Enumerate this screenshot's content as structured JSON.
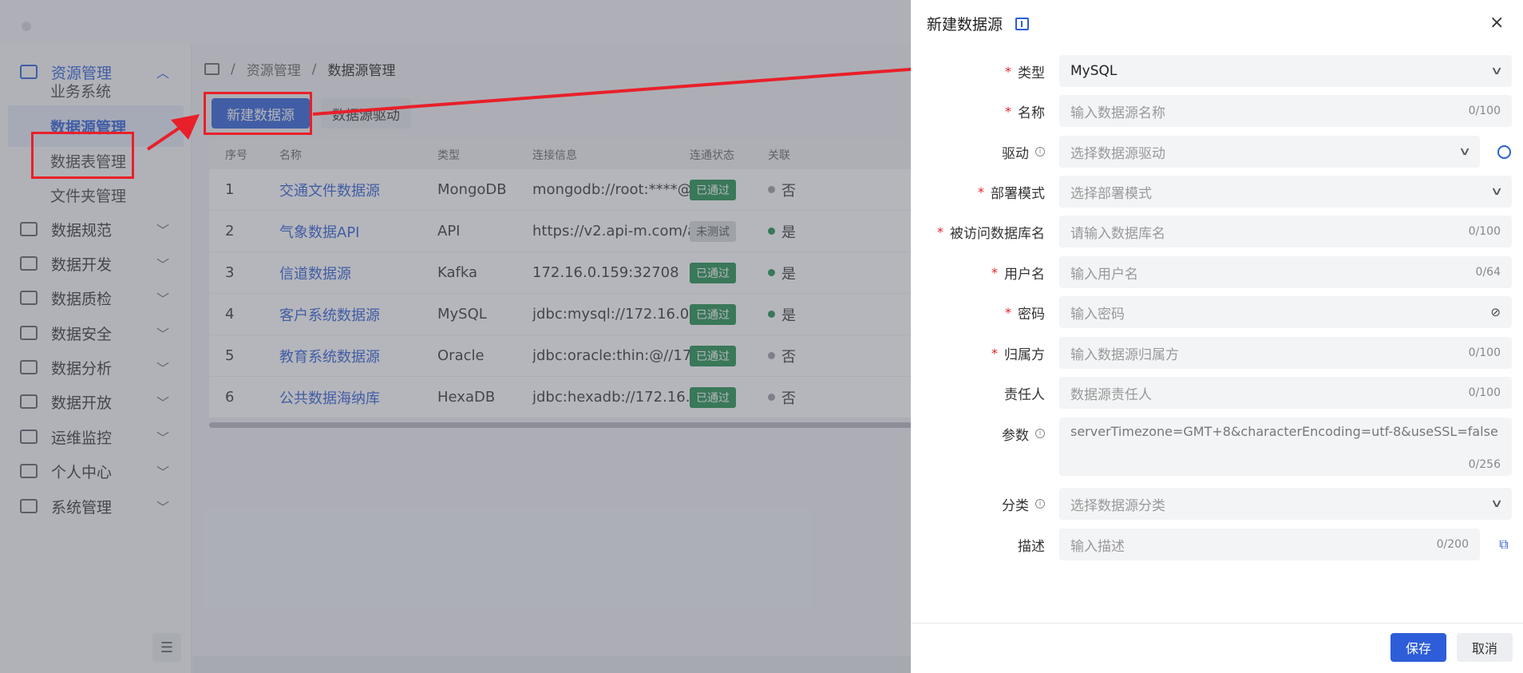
{
  "sidebar": {
    "menu": [
      {
        "label": "资源管理",
        "icon": "monitor-icon",
        "expanded": true
      },
      {
        "label": "数据规范",
        "icon": "display-icon"
      },
      {
        "label": "数据开发",
        "icon": "code-icon"
      },
      {
        "label": "数据质检",
        "icon": "list-icon"
      },
      {
        "label": "数据安全",
        "icon": "check-icon"
      },
      {
        "label": "数据分析",
        "icon": "analysis-icon"
      },
      {
        "label": "数据开放",
        "icon": "open-icon"
      },
      {
        "label": "运维监控",
        "icon": "chart-line-icon"
      },
      {
        "label": "个人中心",
        "icon": "user-icon"
      },
      {
        "label": "系统管理",
        "icon": "settings-icon"
      }
    ],
    "submenu": [
      {
        "label": "业务系统"
      },
      {
        "label": "数据源管理"
      },
      {
        "label": "数据表管理"
      },
      {
        "label": "文件夹管理"
      }
    ]
  },
  "breadcrumb": {
    "root": "资源管理",
    "current": "数据源管理"
  },
  "toolbar": {
    "new_label": "新建数据源",
    "driver_label": "数据源驱动"
  },
  "table": {
    "headers": {
      "no": "序号",
      "name": "名称",
      "type": "类型",
      "conn": "连接信息",
      "status": "连通状态",
      "rel": "关联"
    },
    "rows": [
      {
        "no": "1",
        "name": "交通文件数据源",
        "type": "MongoDB",
        "conn": "mongodb://root:****@...",
        "status": "已通过",
        "rel": "否"
      },
      {
        "no": "2",
        "name": "气象数据API",
        "type": "API",
        "conn": "https://v2.api-m.com/a...",
        "status": "未测试",
        "rel": "是"
      },
      {
        "no": "3",
        "name": "信道数据源",
        "type": "Kafka",
        "conn": "172.16.0.159:32708",
        "status": "已通过",
        "rel": "是"
      },
      {
        "no": "4",
        "name": "客户系统数据源",
        "type": "MySQL",
        "conn": "jdbc:mysql://172.16.0.6...",
        "status": "已通过",
        "rel": "是"
      },
      {
        "no": "5",
        "name": "教育系统数据源",
        "type": "Oracle",
        "conn": "jdbc:oracle:thin:@//17...",
        "status": "已通过",
        "rel": "否"
      },
      {
        "no": "6",
        "name": "公共数据海纳库",
        "type": "HexaDB",
        "conn": "jdbc:hexadb://172.16.0....",
        "status": "已通过",
        "rel": "否"
      }
    ]
  },
  "drawer": {
    "title": "新建数据源",
    "fields": {
      "type": {
        "label": "类型",
        "value": "MySQL"
      },
      "name": {
        "label": "名称",
        "placeholder": "输入数据源名称",
        "count": "0/100"
      },
      "driver": {
        "label": "驱动",
        "placeholder": "选择数据源驱动"
      },
      "deploy": {
        "label": "部署模式",
        "placeholder": "选择部署模式"
      },
      "dbname": {
        "label": "被访问数据库名",
        "placeholder": "请输入数据库名",
        "count": "0/100"
      },
      "username": {
        "label": "用户名",
        "placeholder": "输入用户名",
        "count": "0/64"
      },
      "password": {
        "label": "密码",
        "placeholder": "输入密码"
      },
      "owner": {
        "label": "归属方",
        "placeholder": "输入数据源归属方",
        "count": "0/100"
      },
      "manager": {
        "label": "责任人",
        "placeholder": "数据源责任人",
        "count": "0/100"
      },
      "params": {
        "label": "参数",
        "value": "serverTimezone=GMT+8&characterEncoding=utf-8&useSSL=false",
        "count": "0/256"
      },
      "category": {
        "label": "分类",
        "placeholder": "选择数据源分类"
      },
      "desc": {
        "label": "描述",
        "placeholder": "输入描述",
        "count": "0/200"
      }
    },
    "save_label": "保存",
    "cancel_label": "取消",
    "close_glyph": "×"
  }
}
